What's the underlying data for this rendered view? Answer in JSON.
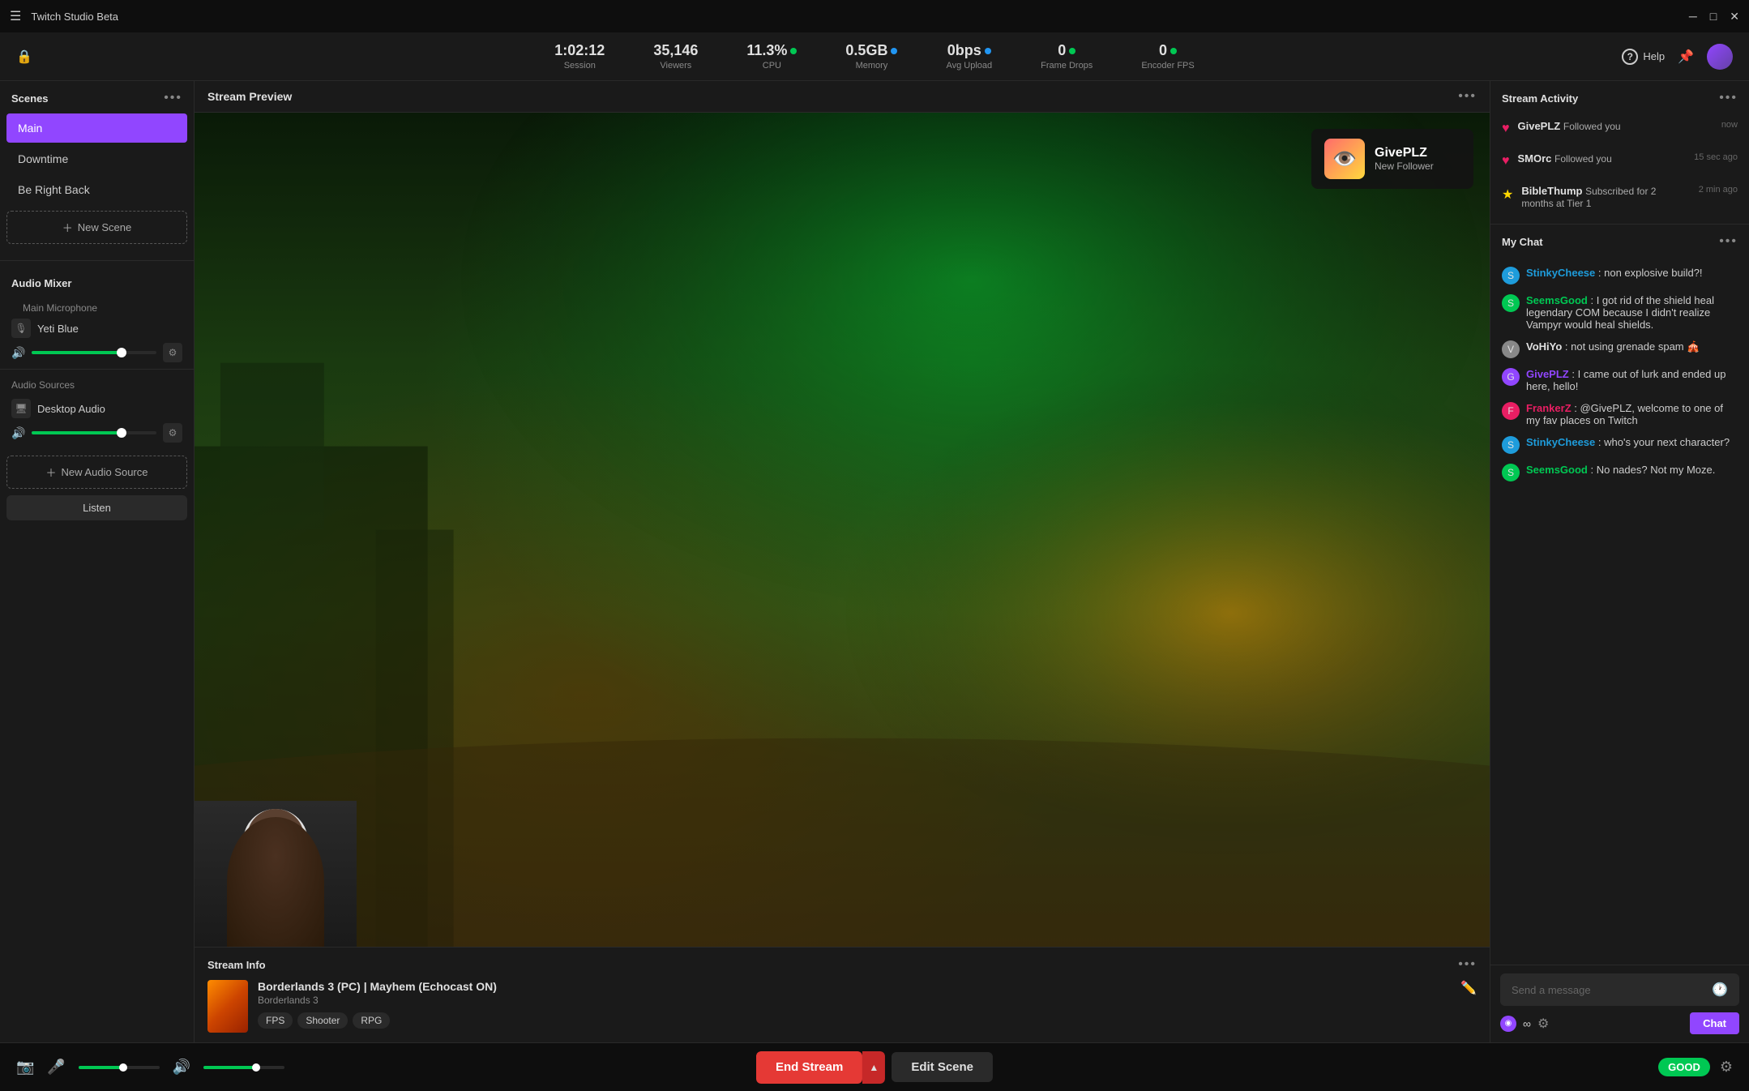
{
  "app": {
    "title": "Twitch Studio Beta",
    "window_controls": {
      "minimize": "─",
      "maximize": "□",
      "close": "✕"
    }
  },
  "statsbar": {
    "session": {
      "value": "1:02:12",
      "label": "Session"
    },
    "viewers": {
      "value": "35,146",
      "label": "Viewers"
    },
    "cpu": {
      "value": "11.3%",
      "label": "CPU",
      "dot": "green"
    },
    "memory": {
      "value": "0.5GB",
      "label": "Memory",
      "dot": "blue"
    },
    "avg_upload": {
      "value": "0bps",
      "label": "Avg Upload",
      "dot": "blue"
    },
    "frame_drops": {
      "value": "0",
      "label": "Frame Drops",
      "dot": "green"
    },
    "encoder_fps": {
      "value": "0",
      "label": "Encoder FPS",
      "dot": "green"
    },
    "help_label": "Help"
  },
  "scenes": {
    "section_title": "Scenes",
    "items": [
      {
        "label": "Main",
        "active": true
      },
      {
        "label": "Downtime",
        "active": false
      },
      {
        "label": "Be Right Back",
        "active": false
      }
    ],
    "new_scene_label": "New Scene"
  },
  "audio_mixer": {
    "section_title": "Audio Mixer",
    "microphone": {
      "subsection_label": "Main Microphone",
      "device_name": "Yeti Blue",
      "slider_fill_pct": 72
    },
    "sources": {
      "subsection_label": "Audio Sources",
      "device_name": "Desktop Audio",
      "slider_fill_pct": 72
    },
    "new_audio_label": "New Audio Source",
    "listen_label": "Listen"
  },
  "stream_preview": {
    "title": "Stream Preview",
    "follower_notification": {
      "name": "GivePLZ",
      "status": "New Follower"
    },
    "preview_emoji": "👁️‍🗨️"
  },
  "stream_info": {
    "title": "Stream Info",
    "game_title": "Borderlands 3 (PC) | Mayhem (Echocast ON)",
    "game_name": "Borderlands 3",
    "tags": [
      "FPS",
      "Shooter",
      "RPG"
    ]
  },
  "stream_activity": {
    "title": "Stream Activity",
    "items": [
      {
        "type": "follow",
        "name": "GivePLZ",
        "action": "Followed you",
        "time": "now"
      },
      {
        "type": "follow",
        "name": "SMOrc",
        "action": "Followed you",
        "time": "15 sec ago"
      },
      {
        "type": "sub",
        "name": "BibleThump",
        "action": "Subscribed for 2 months at Tier 1",
        "time": "2 min ago"
      }
    ]
  },
  "chat": {
    "title": "My Chat",
    "messages": [
      {
        "username": "StinkyCheese",
        "text": "non explosive build?!",
        "color": "#1e9cdb",
        "avatar_bg": "#1e9cdb"
      },
      {
        "username": "SeemsGood",
        "text": "I got rid of the shield heal legendary COM because I didn't realize Vampyr would heal shields.",
        "color": "#00c853",
        "avatar_bg": "#00c853"
      },
      {
        "username": "VoHiYo",
        "text": "not using grenade spam 🎪",
        "color": "#e0e0e0",
        "avatar_bg": "#888"
      },
      {
        "username": "GivePLZ",
        "text": "I came out of lurk and ended up here, hello!",
        "color": "#9146ff",
        "avatar_bg": "#9146ff"
      },
      {
        "username": "FrankerZ",
        "text": "@GivePLZ, welcome to one of my fav places on Twitch",
        "color": "#e91e63",
        "avatar_bg": "#e91e63"
      },
      {
        "username": "StinkyCheese",
        "text": "who's your next character?",
        "color": "#1e9cdb",
        "avatar_bg": "#1e9cdb"
      },
      {
        "username": "SeemsGood",
        "text": "No nades? Not my Moze.",
        "color": "#00c853",
        "avatar_bg": "#00c853"
      }
    ],
    "input_placeholder": "Send a message",
    "send_label": "Chat",
    "infinity": "∞"
  },
  "bottom_bar": {
    "end_stream_label": "End Stream",
    "edit_scene_label": "Edit Scene",
    "quality_label": "GOOD",
    "slider1_fill": 55,
    "slider2_fill": 65
  }
}
